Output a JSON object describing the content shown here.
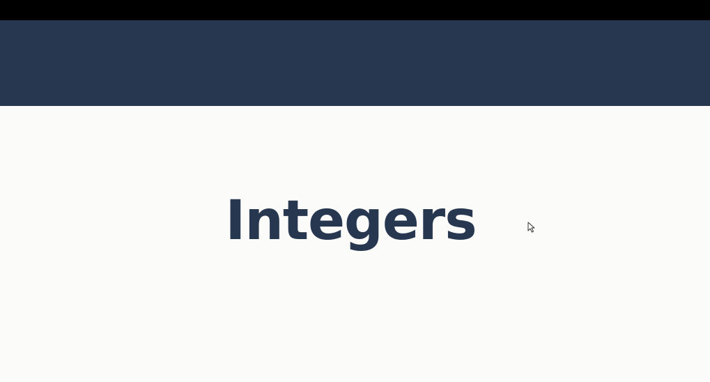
{
  "slide": {
    "title": "Integers"
  },
  "colors": {
    "top_bar": "#000000",
    "header_band": "#27374f",
    "background": "#fbfbfa",
    "title_text": "#27374f"
  },
  "icons": {
    "cursor": "mouse-pointer-icon"
  }
}
